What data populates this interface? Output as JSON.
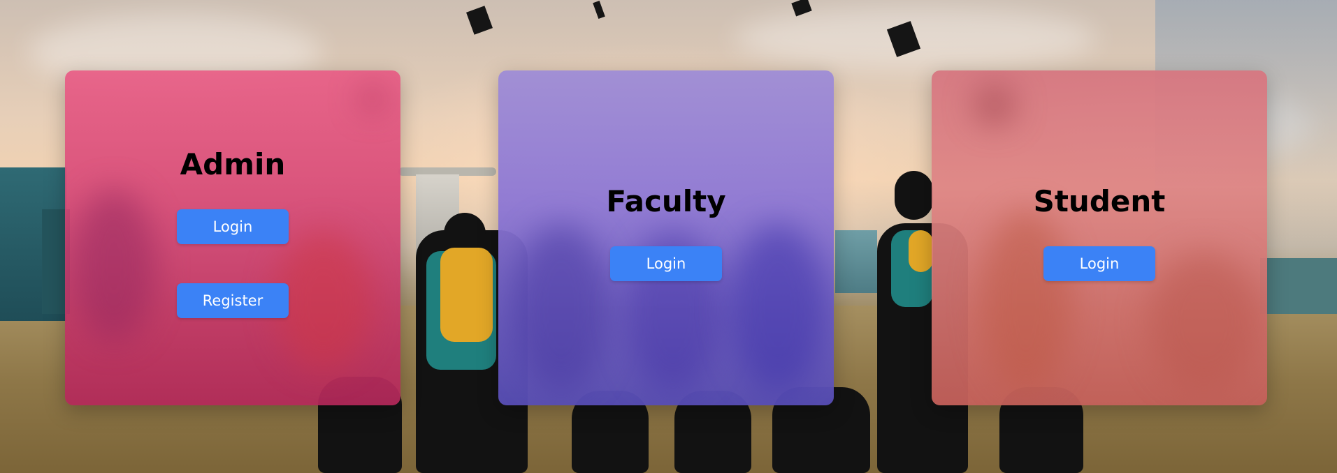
{
  "cards": {
    "admin": {
      "title": "Admin",
      "login_label": "Login",
      "register_label": "Register"
    },
    "faculty": {
      "title": "Faculty",
      "login_label": "Login"
    },
    "student": {
      "title": "Student",
      "login_label": "Login"
    }
  },
  "colors": {
    "button": "#3b82f6",
    "admin_card": "#e25c85",
    "faculty_card": "#9e8cd6",
    "student_card": "#d67680"
  },
  "background": {
    "image_subject": "graduates-tossing-caps-photo"
  }
}
